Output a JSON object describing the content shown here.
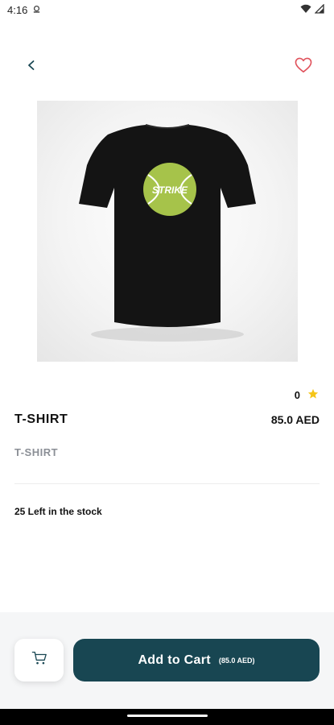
{
  "status_bar": {
    "time": "4:16",
    "icons": [
      "notification-icon",
      "wifi-icon",
      "signal-icon"
    ]
  },
  "header": {
    "back_icon": "chevron-left-icon",
    "favorite_icon": "heart-outline-icon"
  },
  "product": {
    "image_text": "STRIKE",
    "rating_value": "0",
    "rating_icon": "star-icon",
    "title": "T-SHIRT",
    "price": "85.0 AED",
    "subtitle": "T-SHIRT",
    "stock_text": "25 Left in the stock"
  },
  "footer": {
    "cart_icon": "cart-icon",
    "add_to_cart_label": "Add to Cart",
    "add_to_cart_price": "(85.0 AED)"
  },
  "colors": {
    "primary": "#184652",
    "heart": "#e0525c",
    "star": "#f5c518",
    "ball": "#a6c34a",
    "shirt": "#141414"
  }
}
